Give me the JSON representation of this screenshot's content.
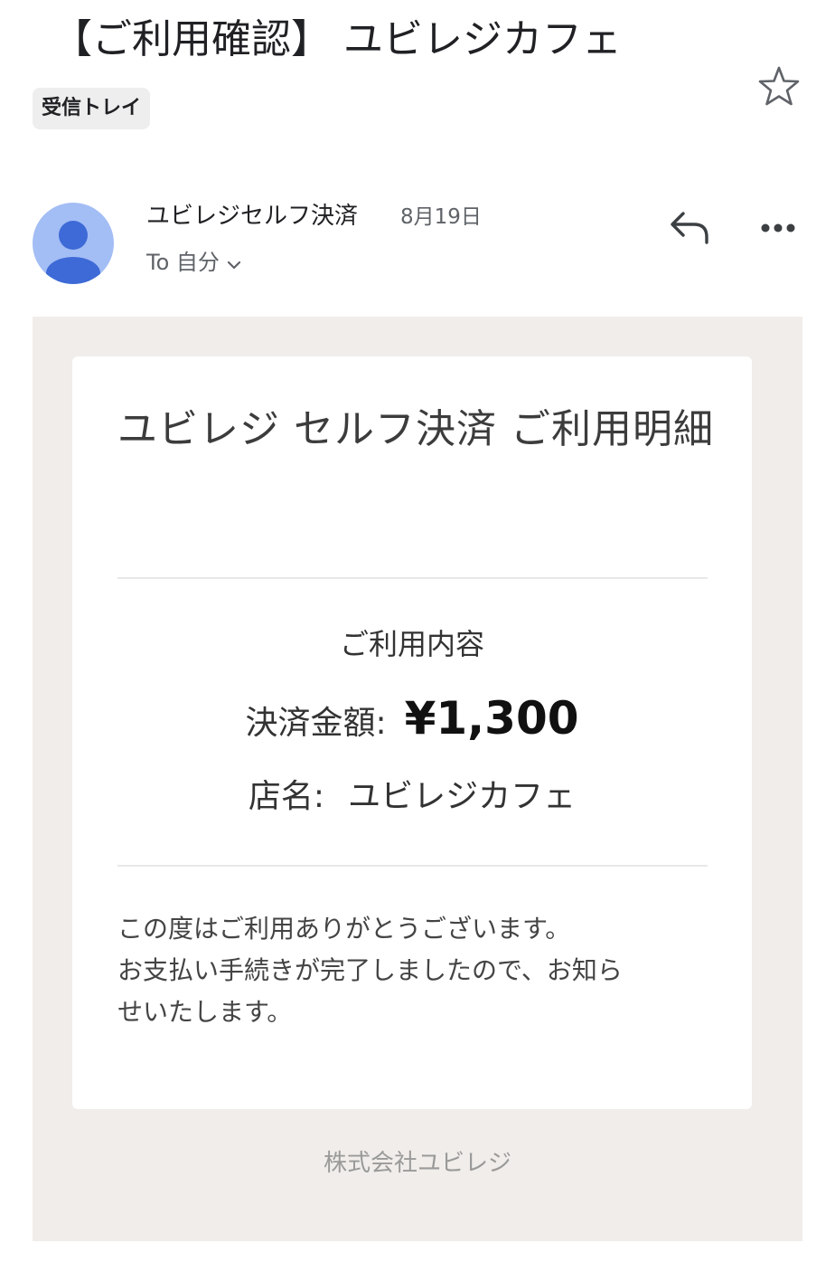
{
  "header": {
    "subject": "【ご利用確認】 ユビレジカフェ",
    "label_chip": "受信トレイ",
    "star_icon": "star-outline-icon"
  },
  "message_meta": {
    "sender": "ユビレジセルフ決済",
    "date": "8月19日",
    "recipient": "To 自分",
    "avatar_icon": "person-icon",
    "reply_icon": "reply-icon",
    "more_icon": "more-horizontal-icon",
    "expand_icon": "chevron-down-icon"
  },
  "email": {
    "title": "ユビレジ セルフ決済 ご利用明細",
    "usage_heading": "ご利用内容",
    "amount_label": "決済金額:",
    "amount_value": "¥1,300",
    "store_label": "店名:",
    "store_name": "ユビレジカフェ",
    "message_lines": [
      "この度はご利用ありがとうございます。",
      "お支払い手続きが完了しましたので、お知ら",
      "せいたします。"
    ],
    "footer_company": "株式会社ユビレジ"
  },
  "colors": {
    "avatar_bg": "#a3bdf5",
    "avatar_figure": "#3d6ad6",
    "email_background": "#f0edea",
    "card_background": "#ffffff"
  }
}
